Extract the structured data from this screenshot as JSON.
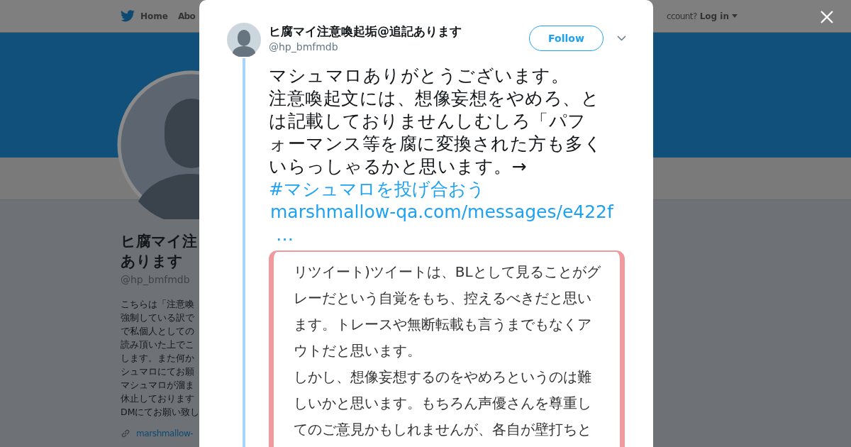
{
  "nav": {
    "items": [
      {
        "label": "Home",
        "kind": "home"
      },
      {
        "label": "Abo",
        "kind": "plain"
      }
    ],
    "account_prompt": "ccount?",
    "login": "Log in"
  },
  "profile": {
    "name_lines": [
      "ヒ腐マイ注",
      "あります"
    ],
    "handle": "@hp_bmfmdb",
    "bio_lines": [
      "こちらは「注意喚",
      "強制している訳で",
      "で私個人としての",
      "読み頂いた上でこ",
      "します。また何か",
      "シュマロにてお願",
      "マシュマロが溜ま",
      "休止しております",
      "DMにてお願い致し"
    ],
    "link": "marshmallow-"
  },
  "tweet": {
    "author": "ヒ腐マイ注意喚起垢@追記あります",
    "handle": "@hp_bmfmdb",
    "follow": "Follow",
    "text_lines": [
      "マシュマロありがとうございます。",
      "注意喚起文には、想像妄想をやめろ、と",
      "は記載しておりませんしむしろ「パフ",
      "ォーマンス等を腐に変換された方も多く",
      "いらっしゃるかと思います。→"
    ],
    "hashtag": "#マシュマロを投げ合おう",
    "url": "marshmallow-qa.com/messages/e422f",
    "ellipsis": "…",
    "attachment": {
      "text_lines": [
        "リツイート)ツイートは、BLとして見ることがグ",
        "レーだという自覚をもち、控えるべきだと思い",
        "ます。トレースや無断転載も言うまでもなくア",
        "ウトだと思います。",
        "しかし、想像妄想するのをやめろというのは難",
        "しいかと思います。もちろん声優さんを尊重し",
        "てのご意見かもしれませんが、各自が壁打ちと"
      ]
    }
  }
}
